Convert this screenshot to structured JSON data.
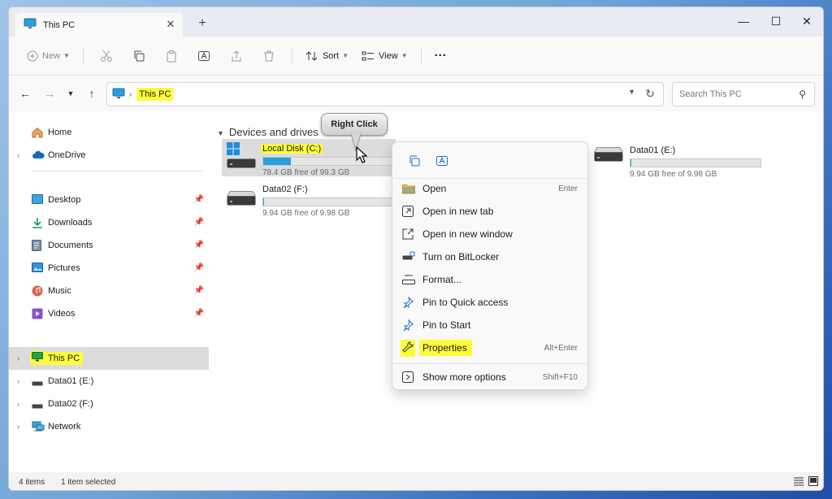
{
  "window": {
    "tab_title": "This PC",
    "new_tab": "+",
    "minimize": "—",
    "maximize": "☐",
    "close": "✕"
  },
  "toolbar": {
    "new_label": "New",
    "sort_label": "Sort",
    "view_label": "View",
    "more_label": "···"
  },
  "address": {
    "location": "This PC",
    "search_placeholder": "Search This PC"
  },
  "sidebar": {
    "pinned": [
      {
        "label": "Home",
        "icon": "home-icon",
        "expandable": false
      },
      {
        "label": "OneDrive",
        "icon": "cloud-icon",
        "expandable": true
      }
    ],
    "quick": [
      {
        "label": "Desktop",
        "icon": "desktop-icon"
      },
      {
        "label": "Downloads",
        "icon": "download-icon"
      },
      {
        "label": "Documents",
        "icon": "document-icon"
      },
      {
        "label": "Pictures",
        "icon": "pictures-icon"
      },
      {
        "label": "Music",
        "icon": "music-icon"
      },
      {
        "label": "Videos",
        "icon": "video-icon"
      }
    ],
    "tree": [
      {
        "label": "This PC",
        "icon": "pc-icon"
      },
      {
        "label": "Data01 (E:)",
        "icon": "drive-icon"
      },
      {
        "label": "Data02 (F:)",
        "icon": "drive-icon"
      },
      {
        "label": "Network",
        "icon": "network-icon"
      }
    ]
  },
  "content": {
    "section_title": "Devices and drives",
    "drives": [
      {
        "name": "Local Disk (C:)",
        "free": "78.4 GB free of 99.3 GB",
        "used_fraction": 0.21
      },
      {
        "name": "Data01 (E:)",
        "free": "9.94 GB free of 9.98 GB",
        "used_fraction": 0.004
      },
      {
        "name": "Data02 (F:)",
        "free": "9.94 GB free of 9.98 GB",
        "used_fraction": 0.004
      }
    ]
  },
  "callout": {
    "label": "Right Click"
  },
  "context_menu": {
    "items": [
      {
        "label": "Open",
        "shortcut": "Enter",
        "icon": "folder-icon"
      },
      {
        "label": "Open in new tab",
        "shortcut": "",
        "icon": "new-tab-icon"
      },
      {
        "label": "Open in new window",
        "shortcut": "",
        "icon": "new-window-icon"
      },
      {
        "label": "Turn on BitLocker",
        "shortcut": "",
        "icon": "bitlocker-icon"
      },
      {
        "label": "Format...",
        "shortcut": "",
        "icon": "format-icon"
      },
      {
        "label": "Pin to Quick access",
        "shortcut": "",
        "icon": "pin-icon"
      },
      {
        "label": "Pin to Start",
        "shortcut": "",
        "icon": "pin-icon"
      },
      {
        "label": "Properties",
        "shortcut": "Alt+Enter",
        "icon": "wrench-icon"
      },
      {
        "label": "Show more options",
        "shortcut": "Shift+F10",
        "icon": "more-options-icon"
      }
    ]
  },
  "status": {
    "items_count": "4 items",
    "selection": "1 item selected"
  },
  "colors": {
    "accent": "#0067c0",
    "highlight": "#fdfc3c",
    "drive_fill": "#26a0da"
  }
}
